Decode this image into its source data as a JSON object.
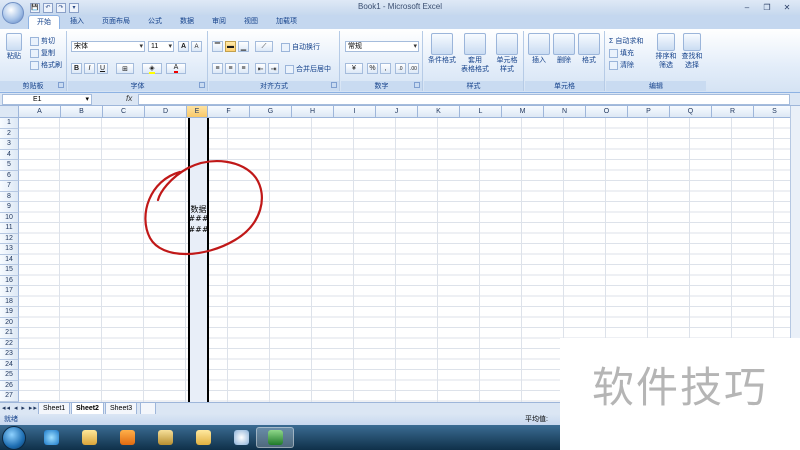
{
  "window": {
    "title": "Book1 - Microsoft Excel",
    "controls": {
      "minimize": "–",
      "restore": "❐",
      "close": "✕"
    }
  },
  "quick_access": [
    "💾",
    "↶",
    "↷",
    "▾"
  ],
  "ribbon_tabs": [
    {
      "label": "开始",
      "active": true
    },
    {
      "label": "插入"
    },
    {
      "label": "页面布局"
    },
    {
      "label": "公式"
    },
    {
      "label": "数据"
    },
    {
      "label": "审阅"
    },
    {
      "label": "视图"
    },
    {
      "label": "加载项"
    }
  ],
  "clipboard": {
    "paste": "粘贴",
    "cut": "剪切",
    "copy": "复制",
    "format_painter": "格式刷",
    "group": "剪贴板"
  },
  "font": {
    "name": "宋体",
    "size": "11",
    "grow": "A",
    "shrink": "A",
    "bold": "B",
    "italic": "I",
    "underline": "U",
    "group": "字体"
  },
  "alignment": {
    "wrap": "自动换行",
    "merge": "合并后居中",
    "group": "对齐方式"
  },
  "number": {
    "format": "常规",
    "percent": "%",
    "comma": ",",
    "group": "数字"
  },
  "styles": {
    "conditional": "条件格式",
    "table": "套用\n表格格式",
    "cell": "单元格\n样式",
    "group": "样式"
  },
  "cells": {
    "insert": "插入",
    "delete": "删除",
    "format": "格式",
    "group": "单元格"
  },
  "editing": {
    "autosum": "自动求和",
    "fill": "填充",
    "clear": "清除",
    "sort": "排序和\n筛选",
    "find": "查找和\n选择",
    "group": "编辑"
  },
  "formula_bar": {
    "name_box": "E1",
    "fx": "fx",
    "value": ""
  },
  "columns": [
    "A",
    "B",
    "C",
    "D",
    "E",
    "F",
    "G",
    "H",
    "I",
    "J",
    "K",
    "L",
    "M",
    "N",
    "O",
    "P",
    "Q",
    "R",
    "S"
  ],
  "rows": [
    "1",
    "2",
    "3",
    "4",
    "5",
    "6",
    "7",
    "8",
    "9",
    "10",
    "11",
    "12",
    "13",
    "14",
    "15",
    "16",
    "17",
    "18",
    "19",
    "20",
    "21",
    "22",
    "23",
    "24",
    "25",
    "26",
    "27"
  ],
  "cells_data": {
    "E9": "数据",
    "E10": "###",
    "E11": "###"
  },
  "sheet_tabs": [
    {
      "label": "Sheet1"
    },
    {
      "label": "Sheet2",
      "active": true
    },
    {
      "label": "Sheet3"
    }
  ],
  "status": {
    "ready": "就绪",
    "average": "平均值:"
  },
  "watermark": "软件技巧",
  "colors": {
    "ribbon": "#dbe6f4",
    "selection_border": "#000000",
    "annotation": "#c01818"
  }
}
